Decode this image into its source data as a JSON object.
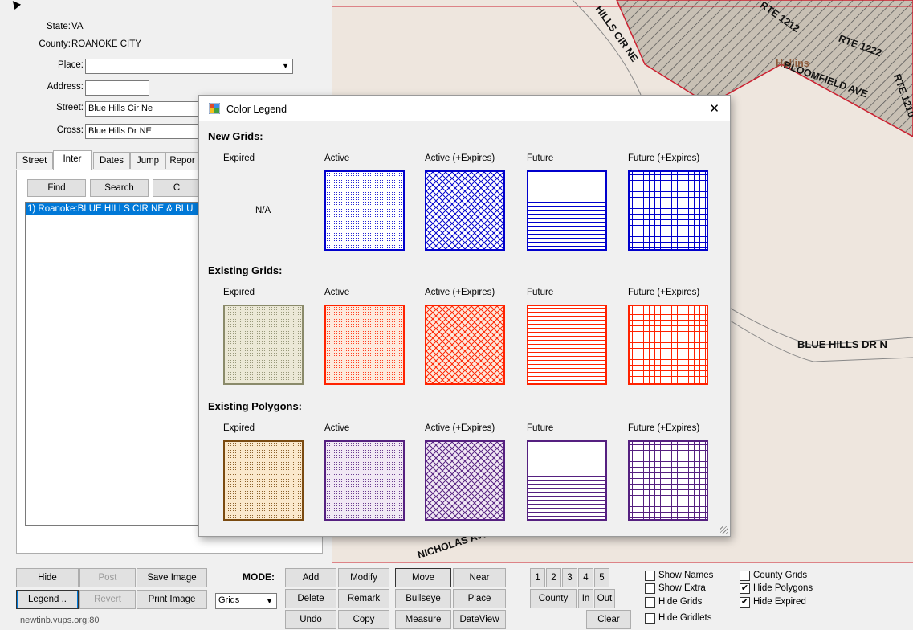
{
  "location": {
    "state_label": "State:",
    "state_value": "VA",
    "county_label": "County:",
    "county_value": "ROANOKE CITY",
    "place_label": "Place:",
    "place_value": "",
    "address_label": "Address:",
    "address_value": "",
    "street_label": "Street:",
    "street_value": "Blue Hills Cir Ne",
    "cross_label": "Cross:",
    "cross_value": "Blue Hills Dr NE"
  },
  "tabs": [
    "Street",
    "Inter",
    "Dates",
    "Jump",
    "Repor"
  ],
  "search_buttons": {
    "find": "Find",
    "search": "Search",
    "third": "C"
  },
  "results": [
    "1) Roanoke:BLUE HILLS CIR NE & BLU"
  ],
  "legend": {
    "title": "Color Legend",
    "close": "✕",
    "columns": [
      "Expired",
      "Active",
      "Active (+Expires)",
      "Future",
      "Future (+Expires)"
    ],
    "na_text": "N/A",
    "sections": [
      {
        "title": "New Grids:",
        "color": "#0000cc",
        "bg": "#ffffff"
      },
      {
        "title": "Existing Grids:",
        "color": "#ff2200",
        "bg": "#fde9dc",
        "expired_color": "#8a8a6a",
        "expired_bg": "#ebe8d6"
      },
      {
        "title": "Existing Polygons:",
        "color": "#552080",
        "bg": "#f1e8f4",
        "expired_color": "#7a4a10",
        "expired_bg": "#fae8cc"
      }
    ]
  },
  "map": {
    "labels": [
      "HILLS CIR NE",
      "RTE 1212",
      "RTE 1222",
      "Hollins",
      "BLOOMFIELD AVE",
      "RTE 1210",
      "BLUE HILLS DR N",
      "NICHOLAS AVE"
    ],
    "colors": {
      "ground": "#eee6de",
      "hatch": "#555555",
      "hatch_bg": "#c8c0b4",
      "border": "#cc2030"
    }
  },
  "toolbar": {
    "hide": "Hide",
    "post": "Post",
    "save_image": "Save Image",
    "legend": "Legend ..",
    "revert": "Revert",
    "print_image": "Print Image",
    "server": "newtinb.vups.org:80",
    "mode_label": "MODE:",
    "mode_value": "Grids",
    "add": "Add",
    "modify": "Modify",
    "delete": "Delete",
    "remark": "Remark",
    "undo": "Undo",
    "copy": "Copy",
    "move": "Move",
    "near": "Near",
    "bullseye": "Bullseye",
    "place": "Place",
    "measure": "Measure",
    "dateview": "DateView",
    "nums": [
      "1",
      "2",
      "3",
      "4",
      "5"
    ],
    "county": "County",
    "in": "In",
    "out": "Out",
    "clear": "Clear"
  },
  "checks": [
    {
      "label": "Show Names",
      "checked": false
    },
    {
      "label": "Show Extra",
      "checked": false
    },
    {
      "label": "Hide Grids",
      "checked": false
    },
    {
      "label": "Hide Gridlets",
      "checked": false
    },
    {
      "label": "County Grids",
      "checked": false
    },
    {
      "label": "Hide Polygons",
      "checked": true
    },
    {
      "label": "Hide Expired",
      "checked": true
    }
  ]
}
